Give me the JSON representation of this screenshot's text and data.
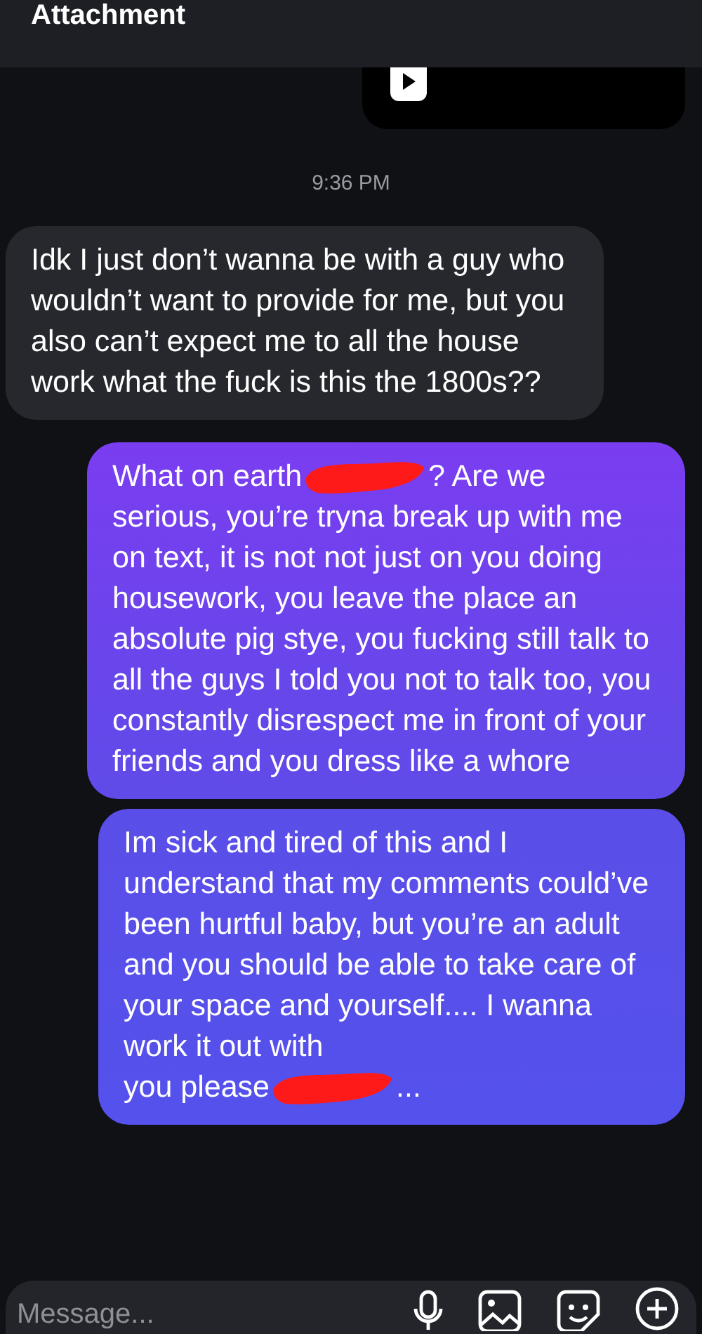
{
  "header": {
    "title": "Attachment"
  },
  "attachment": {
    "kind": "video"
  },
  "timestamp": "9:36 PM",
  "messages": [
    {
      "kind": "incoming",
      "blocks": [
        [
          {
            "kind": "text",
            "text": "Idk I just don’t wanna be with a guy who wouldn’t want to provide for me, but you also can’t expect me to all the house work what the fuck is this the 1800s??"
          }
        ]
      ]
    },
    {
      "kind": "outgoing",
      "blocks": [
        [
          {
            "kind": "text",
            "text": "What on earth"
          },
          {
            "kind": "redaction"
          },
          {
            "kind": "text",
            "text": "? Are we"
          }
        ],
        [
          {
            "kind": "text",
            "text": "serious, you’re tryna break up with me on text, it is not not just on you doing housework, you leave the place an absolute pig stye, you fucking still talk to all the guys I told you not to talk too, you constantly disrespect me in front of your friends and you dress like a whore"
          }
        ]
      ]
    },
    {
      "kind": "outgoing",
      "blocks": [
        [
          {
            "kind": "text",
            "text": "Im sick and tired of this and I understand that my comments could’ve been hurtful baby, but you’re an adult and you should be able to take care of your space and yourself.... I wanna work it out with"
          }
        ],
        [
          {
            "kind": "text",
            "text": "you please"
          },
          {
            "kind": "redaction"
          },
          {
            "kind": "text",
            "text": "..."
          }
        ]
      ]
    }
  ],
  "composer": {
    "placeholder": "Message..."
  }
}
